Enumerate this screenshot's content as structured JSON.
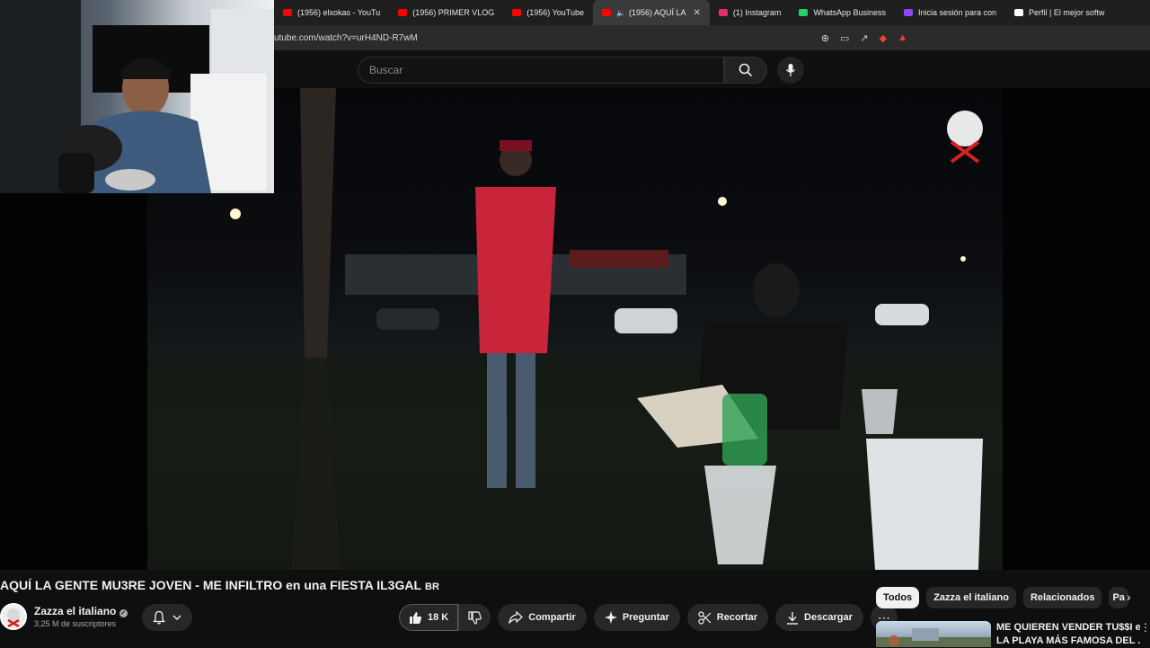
{
  "browser": {
    "tabs": [
      {
        "label": "(1956) elxokas - YouTu",
        "icon": "youtube-icon",
        "color": "#ff0000"
      },
      {
        "label": "(1956) PRIMER VLOG",
        "icon": "youtube-icon",
        "color": "#ff0000"
      },
      {
        "label": "(1956) YouTube",
        "icon": "youtube-icon",
        "color": "#ff0000"
      },
      {
        "label": "(1956) AQUÍ LA",
        "icon": "youtube-icon",
        "color": "#ff0000",
        "active": true
      },
      {
        "label": "(1) Instagram",
        "icon": "instagram-icon",
        "color": "#e1306c"
      },
      {
        "label": "WhatsApp Business",
        "icon": "whatsapp-icon",
        "color": "#25d366"
      },
      {
        "label": "Inicia sesión para con",
        "icon": "twitch-icon",
        "color": "#9146ff"
      },
      {
        "label": "Perfil | El mejor softw",
        "icon": "diamond-icon",
        "color": "#ffffff"
      }
    ],
    "url": "utube.com/watch?v=urH4ND-R7wM"
  },
  "youtube": {
    "search_placeholder": "Buscar",
    "video_title": "AQUÍ LA GENTE MU3RE JOVEN - ME INFILTRO en una FIESTA IL3GAL",
    "title_badge": "BR",
    "channel_name": "Zazza el italiano",
    "subscribers": "3,25 M de suscriptores",
    "like_count": "18 K",
    "actions": {
      "share": "Compartir",
      "ask": "Preguntar",
      "clip": "Recortar",
      "download": "Descargar"
    },
    "chips": [
      "Todos",
      "Zazza el italiano",
      "Relacionados",
      "Pa"
    ],
    "recommendation": {
      "title_line1": "ME QUIEREN VENDER TU$$I en",
      "title_line2": "LA PLAYA MÁS FAMOSA DEL ..."
    }
  },
  "colors": {
    "accent": "#ff0000",
    "background": "#0f0f0f",
    "chip_bg": "#272727"
  }
}
